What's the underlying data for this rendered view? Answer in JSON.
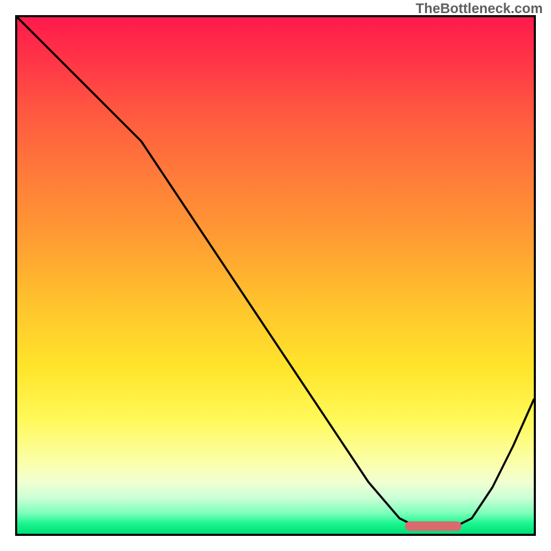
{
  "watermark": "TheBottleneck.com",
  "colors": {
    "border": "#000000",
    "curve": "#000000",
    "marker": "#d96b6f",
    "watermark": "#5f5f5f"
  },
  "chart_data": {
    "type": "line",
    "title": "",
    "xlabel": "",
    "ylabel": "",
    "xlim": [
      0,
      100
    ],
    "ylim": [
      0,
      100
    ],
    "grid": false,
    "series": [
      {
        "name": "bottleneck-curve",
        "x": [
          0,
          8,
          16,
          24,
          28,
          36,
          44,
          52,
          60,
          68,
          74,
          78,
          84,
          88,
          92,
          96,
          100
        ],
        "y": [
          100,
          92,
          84,
          76,
          70,
          58,
          46,
          34,
          22,
          10,
          3,
          1,
          1,
          3,
          9,
          17,
          26
        ]
      }
    ],
    "annotations": [
      {
        "name": "optimal-range-marker",
        "type": "hbar",
        "x_start": 75,
        "x_end": 86,
        "y": 1.5,
        "color": "#d96b6f"
      }
    ],
    "background": {
      "type": "vertical-heat-gradient",
      "stops": [
        {
          "pos": 0.0,
          "color": "#ff1a4c"
        },
        {
          "pos": 0.3,
          "color": "#ff7a3a"
        },
        {
          "pos": 0.55,
          "color": "#ffc22d"
        },
        {
          "pos": 0.78,
          "color": "#fff95a"
        },
        {
          "pos": 0.92,
          "color": "#ccffd6"
        },
        {
          "pos": 1.0,
          "color": "#00df77"
        }
      ]
    }
  }
}
